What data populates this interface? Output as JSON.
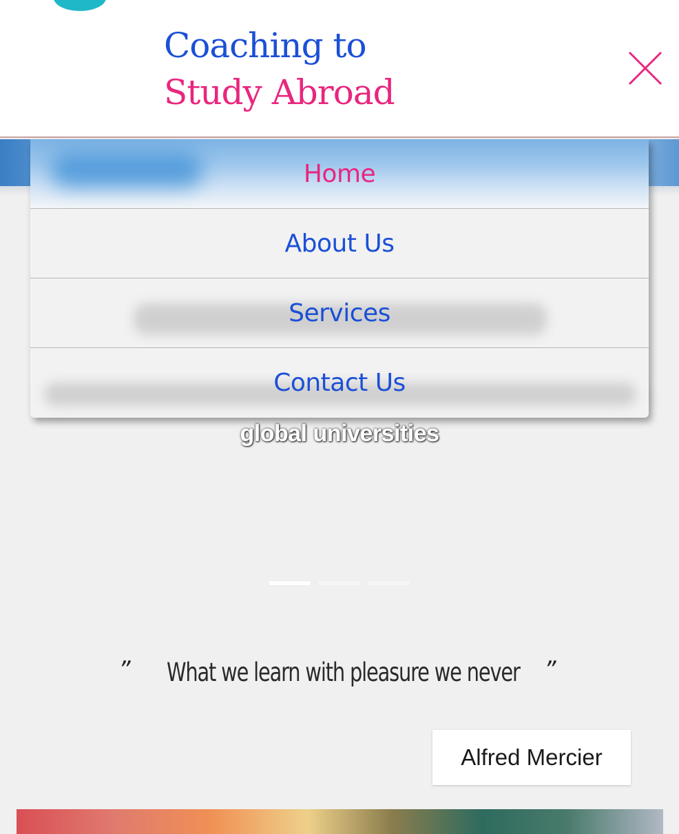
{
  "brand": {
    "line1": "Coaching to",
    "line2": "Study Abroad",
    "color_primary": "#1b4fd6",
    "color_accent": "#e8267f"
  },
  "header": {
    "close_icon": "close-icon"
  },
  "menu": {
    "items": [
      {
        "label": "Home",
        "active": true
      },
      {
        "label": "About Us",
        "active": false
      },
      {
        "label": "Services",
        "active": false
      },
      {
        "label": "Contact Us",
        "active": false
      }
    ]
  },
  "hero": {
    "caption": "global universities",
    "slides": {
      "count": 3,
      "active_index": 0
    }
  },
  "quote": {
    "open_mark": "”",
    "text": "What we learn with pleasure we never",
    "close_mark": "”",
    "author": "Alfred Mercier"
  }
}
